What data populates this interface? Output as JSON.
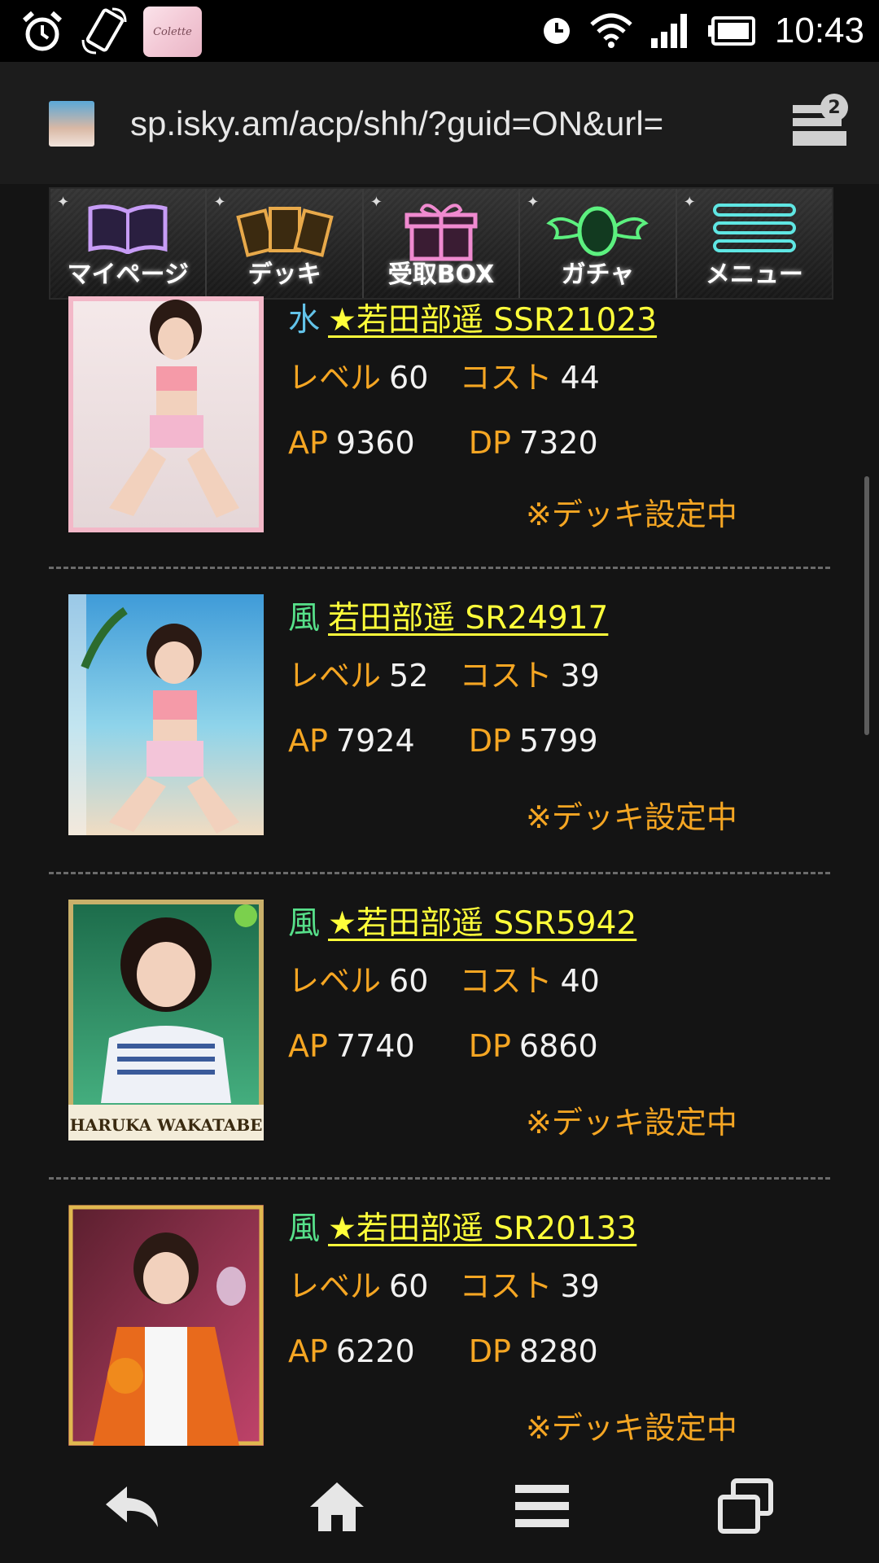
{
  "status_bar": {
    "time": "10:43",
    "icons": [
      "alarm-icon",
      "screen-rotate-icon",
      "app-notification-icon",
      "clock-icon",
      "wifi-icon",
      "signal-icon",
      "battery-icon"
    ],
    "app_thumb_text": "Colette"
  },
  "browser": {
    "url": "sp.isky.am/acp/shh/?guid=ON&url=",
    "tab_count": "2"
  },
  "menu": {
    "items": [
      {
        "label": "マイページ",
        "icon": "book-icon",
        "color": "#c79cf6"
      },
      {
        "label": "デッキ",
        "icon": "cards-icon",
        "color": "#e8a94a"
      },
      {
        "label": "受取BOX",
        "icon": "gift-icon",
        "color": "#f08ad0"
      },
      {
        "label": "ガチャ",
        "icon": "winged-egg-icon",
        "color": "#5cf07f"
      },
      {
        "label": "メニュー",
        "icon": "list-icon",
        "color": "#5fe6e3"
      }
    ]
  },
  "cards": [
    {
      "attribute": "水",
      "name": "★若田部遥 SSR21023",
      "level_label": "レベル",
      "level": "60",
      "cost_label": "コスト",
      "cost": "44",
      "ap_label": "AP",
      "ap": "9360",
      "dp_label": "DP",
      "dp": "7320",
      "status": "※デッキ設定中"
    },
    {
      "attribute": "風",
      "name": "若田部遥 SR24917",
      "level_label": "レベル",
      "level": "52",
      "cost_label": "コスト",
      "cost": "39",
      "ap_label": "AP",
      "ap": "7924",
      "dp_label": "DP",
      "dp": "5799",
      "status": "※デッキ設定中"
    },
    {
      "attribute": "風",
      "name": "★若田部遥 SSR5942",
      "level_label": "レベル",
      "level": "60",
      "cost_label": "コスト",
      "cost": "40",
      "ap_label": "AP",
      "ap": "7740",
      "dp_label": "DP",
      "dp": "6860",
      "status": "※デッキ設定中",
      "card_caption": "HARUKA WAKATABE"
    },
    {
      "attribute": "風",
      "name": "★若田部遥 SR20133",
      "level_label": "レベル",
      "level": "60",
      "cost_label": "コスト",
      "cost": "39",
      "ap_label": "AP",
      "ap": "6220",
      "dp_label": "DP",
      "dp": "8280",
      "status": "※デッキ設定中"
    }
  ],
  "bottom_nav": [
    "back-icon",
    "home-icon",
    "menu-icon",
    "windows-icon"
  ]
}
